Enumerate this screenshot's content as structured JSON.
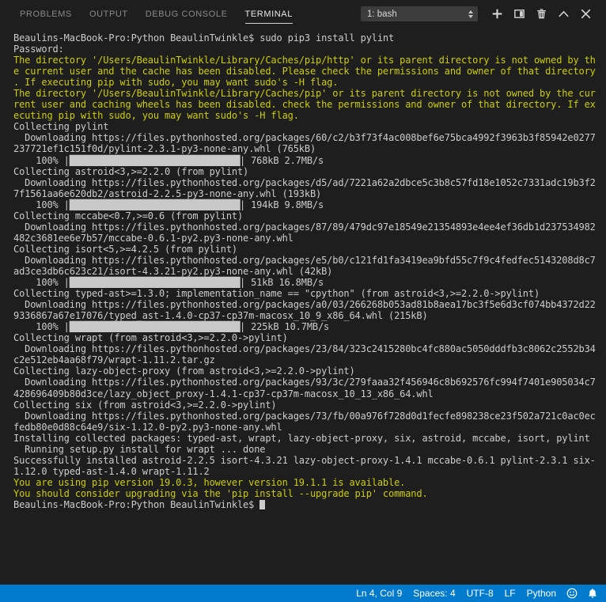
{
  "panel": {
    "tabs": [
      {
        "label": "PROBLEMS",
        "name": "tab-problems",
        "active": false
      },
      {
        "label": "OUTPUT",
        "name": "tab-output",
        "active": false
      },
      {
        "label": "DEBUG CONSOLE",
        "name": "tab-debug-console",
        "active": false
      },
      {
        "label": "TERMINAL",
        "name": "tab-terminal",
        "active": true
      }
    ],
    "terminal_select": {
      "value": "1: bash",
      "options": [
        "1: bash"
      ]
    },
    "actions": [
      {
        "name": "new-terminal-button",
        "icon": "plus-icon",
        "title": "New Terminal"
      },
      {
        "name": "split-terminal-button",
        "icon": "split-icon",
        "title": "Split Terminal"
      },
      {
        "name": "kill-terminal-button",
        "icon": "trash-icon",
        "title": "Kill Terminal"
      },
      {
        "name": "maximize-panel-button",
        "icon": "chevron-up-icon",
        "title": "Maximize Panel"
      },
      {
        "name": "close-panel-button",
        "icon": "close-icon",
        "title": "Close Panel"
      }
    ]
  },
  "colors": {
    "background": "#1e1e1e",
    "foreground": "#cccccc",
    "warning": "#cdcd00",
    "status_bar": "#007acc",
    "tab_active": "#e7e7e7",
    "tab_inactive": "#8a8a8a"
  },
  "terminal": {
    "prompt": "Beaulins-MacBook-Pro:Python BeaulinTwinkle$ ",
    "command": "sudo pip3 install pylint",
    "lines": [
      {
        "text": "Beaulins-MacBook-Pro:Python BeaulinTwinkle$ sudo pip3 install pylint",
        "style": "normal"
      },
      {
        "text": "Password:",
        "style": "normal"
      },
      {
        "text": "The directory '/Users/BeaulinTwinkle/Library/Caches/pip/http' or its parent directory is not owned by th",
        "style": "warn"
      },
      {
        "text": "e current user and the cache has been disabled. Please check the permissions and owner of that directory",
        "style": "warn"
      },
      {
        "text": ". If executing pip with sudo, you may want sudo's -H flag.",
        "style": "warn"
      },
      {
        "text": "The directory '/Users/BeaulinTwinkle/Library/Caches/pip' or its parent directory is not owned by the cur",
        "style": "warn"
      },
      {
        "text": "rent user and caching wheels has been disabled. check the permissions and owner of that directory. If ex",
        "style": "warn"
      },
      {
        "text": "ecuting pip with sudo, you may want sudo's -H flag.",
        "style": "warn"
      },
      {
        "text": "Collecting pylint",
        "style": "normal"
      },
      {
        "text": "  Downloading https://files.pythonhosted.org/packages/60/c2/b3f73f4ac008bef6e75bca4992f3963b3f85942e0277",
        "style": "normal"
      },
      {
        "text": "237721ef1c151f0d/pylint-2.3.1-py3-none-any.whl (765kB)",
        "style": "normal"
      },
      {
        "text": "    100% |████████████████████████████████| 768kB 2.7MB/s ",
        "style": "normal"
      },
      {
        "text": "Collecting astroid<3,>=2.2.0 (from pylint)",
        "style": "normal"
      },
      {
        "text": "  Downloading https://files.pythonhosted.org/packages/d5/ad/7221a62a2dbce5c3b8c57fd18e1052c7331adc19b3f2",
        "style": "normal"
      },
      {
        "text": "7f1561aa6e620db2/astroid-2.2.5-py3-none-any.whl (193kB)",
        "style": "normal"
      },
      {
        "text": "    100% |████████████████████████████████| 194kB 9.8MB/s ",
        "style": "normal"
      },
      {
        "text": "Collecting mccabe<0.7,>=0.6 (from pylint)",
        "style": "normal"
      },
      {
        "text": "  Downloading https://files.pythonhosted.org/packages/87/89/479dc97e18549e21354893e4ee4ef36db1d237534982",
        "style": "normal"
      },
      {
        "text": "482c3681ee6e7b57/mccabe-0.6.1-py2.py3-none-any.whl",
        "style": "normal"
      },
      {
        "text": "Collecting isort<5,>=4.2.5 (from pylint)",
        "style": "normal"
      },
      {
        "text": "  Downloading https://files.pythonhosted.org/packages/e5/b0/c121fd1fa3419ea9bfd55c7f9c4fedfec5143208d8c7",
        "style": "normal"
      },
      {
        "text": "ad3ce3db6c623c21/isort-4.3.21-py2.py3-none-any.whl (42kB)",
        "style": "normal"
      },
      {
        "text": "    100% |████████████████████████████████| 51kB 16.8MB/s ",
        "style": "normal"
      },
      {
        "text": "Collecting typed-ast>=1.3.0; implementation_name == \"cpython\" (from astroid<3,>=2.2.0->pylint)",
        "style": "normal"
      },
      {
        "text": "  Downloading https://files.pythonhosted.org/packages/a0/03/266268b053ad81b8aea17bc3f5e6d3cf074bb4372d22",
        "style": "normal"
      },
      {
        "text": "9336867a67e17076/typed_ast-1.4.0-cp37-cp37m-macosx_10_9_x86_64.whl (215kB)",
        "style": "normal"
      },
      {
        "text": "    100% |████████████████████████████████| 225kB 10.7MB/s ",
        "style": "normal"
      },
      {
        "text": "Collecting wrapt (from astroid<3,>=2.2.0->pylint)",
        "style": "normal"
      },
      {
        "text": "  Downloading https://files.pythonhosted.org/packages/23/84/323c2415280bc4fc880ac5050dddfb3c8062c2552b34",
        "style": "normal"
      },
      {
        "text": "c2e512eb4aa68f79/wrapt-1.11.2.tar.gz",
        "style": "normal"
      },
      {
        "text": "Collecting lazy-object-proxy (from astroid<3,>=2.2.0->pylint)",
        "style": "normal"
      },
      {
        "text": "  Downloading https://files.pythonhosted.org/packages/93/3c/279faaa32f456946c8b692576fc994f7401e905034c7",
        "style": "normal"
      },
      {
        "text": "428696409b80d3ce/lazy_object_proxy-1.4.1-cp37-cp37m-macosx_10_13_x86_64.whl",
        "style": "normal"
      },
      {
        "text": "Collecting six (from astroid<3,>=2.2.0->pylint)",
        "style": "normal"
      },
      {
        "text": "  Downloading https://files.pythonhosted.org/packages/73/fb/00a976f728d0d1fecfe898238ce23f502a721c0ac0ec",
        "style": "normal"
      },
      {
        "text": "fedb80e0d88c64e9/six-1.12.0-py2.py3-none-any.whl",
        "style": "normal"
      },
      {
        "text": "Installing collected packages: typed-ast, wrapt, lazy-object-proxy, six, astroid, mccabe, isort, pylint",
        "style": "normal"
      },
      {
        "text": "  Running setup.py install for wrapt ... done",
        "style": "normal"
      },
      {
        "text": "Successfully installed astroid-2.2.5 isort-4.3.21 lazy-object-proxy-1.4.1 mccabe-0.6.1 pylint-2.3.1 six-",
        "style": "normal"
      },
      {
        "text": "1.12.0 typed-ast-1.4.0 wrapt-1.11.2",
        "style": "normal"
      },
      {
        "text": "You are using pip version 19.0.3, however version 19.1.1 is available.",
        "style": "warn"
      },
      {
        "text": "You should consider upgrading via the 'pip install --upgrade pip' command.",
        "style": "warn"
      },
      {
        "text": "Beaulins-MacBook-Pro:Python BeaulinTwinkle$ ",
        "style": "prompt"
      }
    ],
    "downloads": [
      {
        "package": "pylint",
        "version": "2.3.1",
        "size": "765kB",
        "downloaded": "768kB",
        "speed": "2.7MB/s",
        "percent": 100
      },
      {
        "package": "astroid",
        "version": "2.2.5",
        "size": "193kB",
        "downloaded": "194kB",
        "speed": "9.8MB/s",
        "percent": 100
      },
      {
        "package": "mccabe",
        "version": "0.6.1",
        "size": "",
        "downloaded": "",
        "speed": "",
        "percent": null
      },
      {
        "package": "isort",
        "version": "4.3.21",
        "size": "42kB",
        "downloaded": "51kB",
        "speed": "16.8MB/s",
        "percent": 100
      },
      {
        "package": "typed_ast",
        "version": "1.4.0",
        "size": "215kB",
        "downloaded": "225kB",
        "speed": "10.7MB/s",
        "percent": 100
      },
      {
        "package": "wrapt",
        "version": "1.11.2",
        "size": "",
        "downloaded": "",
        "speed": "",
        "percent": null
      },
      {
        "package": "lazy_object_proxy",
        "version": "1.4.1",
        "size": "",
        "downloaded": "",
        "speed": "",
        "percent": null
      },
      {
        "package": "six",
        "version": "1.12.0",
        "size": "",
        "downloaded": "",
        "speed": "",
        "percent": null
      }
    ]
  },
  "status_bar": {
    "items": [
      {
        "name": "status-cursor-position",
        "label": "Ln 4, Col 9",
        "type": "text"
      },
      {
        "name": "status-indentation",
        "label": "Spaces: 4",
        "type": "text"
      },
      {
        "name": "status-encoding",
        "label": "UTF-8",
        "type": "text"
      },
      {
        "name": "status-eol",
        "label": "LF",
        "type": "text"
      },
      {
        "name": "status-language-mode",
        "label": "Python",
        "type": "text"
      },
      {
        "name": "status-feedback-smiley-icon",
        "label": "",
        "type": "icon",
        "icon": "smiley-icon"
      },
      {
        "name": "status-notifications-bell-icon",
        "label": "",
        "type": "icon",
        "icon": "bell-icon"
      }
    ]
  }
}
